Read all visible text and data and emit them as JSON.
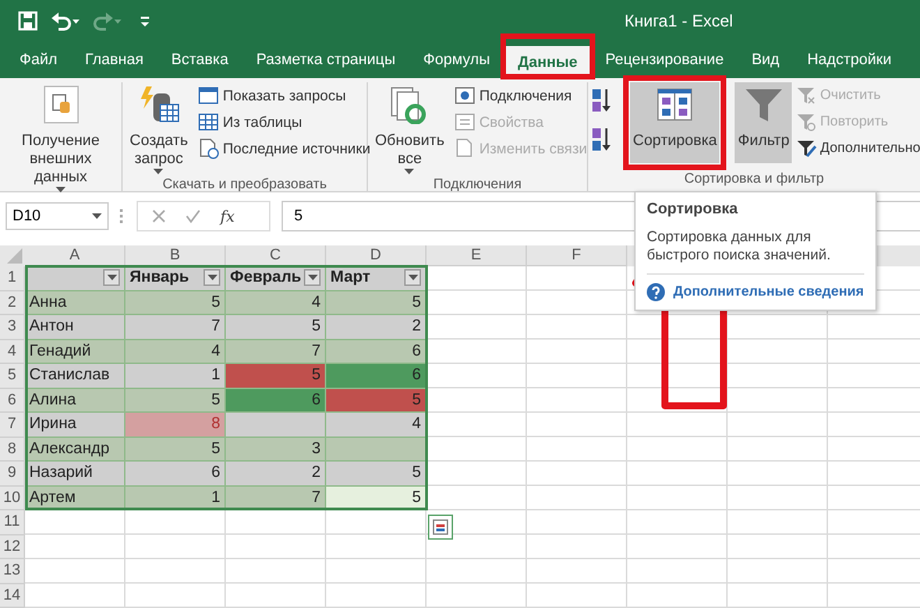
{
  "window": {
    "title": "Книга1  -  Excel"
  },
  "quick_access": [
    {
      "kind": "save",
      "disabled": false
    },
    {
      "kind": "undo",
      "disabled": false
    },
    {
      "kind": "redo",
      "disabled": true
    },
    {
      "kind": "customize",
      "disabled": false
    }
  ],
  "tabs": [
    {
      "label": "Файл",
      "selected": false
    },
    {
      "label": "Главная",
      "selected": false
    },
    {
      "label": "Вставка",
      "selected": false
    },
    {
      "label": "Разметка страницы",
      "selected": false
    },
    {
      "label": "Формулы",
      "selected": false
    },
    {
      "label": "Данные",
      "selected": true
    },
    {
      "label": "Рецензирование",
      "selected": false
    },
    {
      "label": "Вид",
      "selected": false
    },
    {
      "label": "Надстройки",
      "selected": false
    }
  ],
  "ribbon": {
    "groups": [
      {
        "items": [
          {
            "kind": "big",
            "label": "Получение внешних данных",
            "dropdown": true,
            "pressed": false,
            "disabled": false
          }
        ]
      },
      {
        "label": "Скачать и преобразовать",
        "items": [
          {
            "kind": "big",
            "label": "Создать запрос",
            "dropdown": true,
            "pressed": false,
            "disabled": false
          },
          {
            "kind": "small",
            "label": "Показать запросы",
            "disabled": false
          },
          {
            "kind": "small",
            "label": "Из таблицы",
            "disabled": false
          },
          {
            "kind": "small",
            "label": "Последние источники",
            "disabled": false
          }
        ]
      },
      {
        "label": "Подключения",
        "items": [
          {
            "kind": "big",
            "label": "Обновить все",
            "dropdown": true,
            "pressed": false,
            "disabled": false
          },
          {
            "kind": "small",
            "label": "Подключения",
            "disabled": false
          },
          {
            "kind": "small",
            "label": "Свойства",
            "disabled": true
          },
          {
            "kind": "small",
            "label": "Изменить связи",
            "disabled": true
          }
        ]
      },
      {
        "label": "Сортировка и фильтр",
        "items": [
          {
            "kind": "sortpair"
          },
          {
            "kind": "big",
            "label": "Сортировка",
            "dropdown": false,
            "pressed": true,
            "disabled": false
          },
          {
            "kind": "big",
            "label": "Фильтр",
            "dropdown": false,
            "pressed": true,
            "disabled": false
          },
          {
            "kind": "small",
            "label": "Очистить",
            "disabled": true
          },
          {
            "kind": "small",
            "label": "Повторить",
            "disabled": true
          },
          {
            "kind": "small",
            "label": "Дополнительно",
            "disabled": false
          }
        ]
      }
    ]
  },
  "formula_bar": {
    "name_box": "D10",
    "function_button": "fx",
    "value": "5"
  },
  "sheet": {
    "columns": [
      "A",
      "B",
      "C",
      "D",
      "E",
      "F"
    ],
    "rows": [
      {
        "number": "1",
        "cells": [
          {
            "kind": "header"
          },
          {
            "value": "Январь",
            "kind": "header"
          },
          {
            "value": "Февраль",
            "kind": "header"
          },
          {
            "value": "Март",
            "kind": "header"
          }
        ]
      },
      {
        "number": "2",
        "cells": [
          {
            "value": "Анна",
            "kind": "text"
          },
          {
            "value": "5",
            "kind": "number"
          },
          {
            "value": "4",
            "kind": "number"
          },
          {
            "value": "5",
            "kind": "number"
          }
        ]
      },
      {
        "number": "3",
        "cells": [
          {
            "value": "Антон",
            "kind": "text"
          },
          {
            "value": "7",
            "kind": "number"
          },
          {
            "value": "5",
            "kind": "number"
          },
          {
            "value": "2",
            "kind": "number"
          }
        ]
      },
      {
        "number": "4",
        "cells": [
          {
            "value": "Генадий",
            "kind": "text"
          },
          {
            "value": "4",
            "kind": "number"
          },
          {
            "value": "7",
            "kind": "number"
          },
          {
            "value": "6",
            "kind": "number"
          }
        ]
      },
      {
        "number": "5",
        "cells": [
          {
            "value": "Станислав",
            "kind": "text"
          },
          {
            "value": "1",
            "kind": "number"
          },
          {
            "value": "5",
            "kind": "number",
            "color": "#c0504d"
          },
          {
            "value": "6",
            "kind": "number",
            "color": "#4e9a5e"
          }
        ]
      },
      {
        "number": "6",
        "cells": [
          {
            "value": "Алина",
            "kind": "text"
          },
          {
            "value": "5",
            "kind": "number"
          },
          {
            "value": "6",
            "kind": "number",
            "color": "#4e9a5e"
          },
          {
            "value": "5",
            "kind": "number",
            "color": "#c0504d"
          }
        ]
      },
      {
        "number": "7",
        "cells": [
          {
            "value": "Ирина",
            "kind": "text"
          },
          {
            "value": "8",
            "kind": "number",
            "color": "#d4a0a0"
          },
          {
            "kind": "number"
          },
          {
            "value": "4",
            "kind": "number"
          }
        ]
      },
      {
        "number": "8",
        "cells": [
          {
            "value": "Александр",
            "kind": "text"
          },
          {
            "value": "5",
            "kind": "number"
          },
          {
            "value": "3",
            "kind": "number"
          },
          {
            "kind": "number"
          }
        ]
      },
      {
        "number": "9",
        "cells": [
          {
            "value": "Назарий",
            "kind": "text"
          },
          {
            "value": "6",
            "kind": "number"
          },
          {
            "value": "2",
            "kind": "number"
          },
          {
            "value": "5",
            "kind": "number"
          }
        ]
      },
      {
        "number": "10",
        "cells": [
          {
            "value": "Артем",
            "kind": "text"
          },
          {
            "value": "1",
            "kind": "number"
          },
          {
            "value": "7",
            "kind": "number"
          },
          {
            "value": "5",
            "kind": "number",
            "color": "#e6f0de"
          }
        ]
      },
      {
        "number": "11"
      },
      {
        "number": "12"
      },
      {
        "number": "13"
      },
      {
        "number": "14"
      }
    ]
  },
  "tooltip": {
    "title": "Сортировка",
    "text": "Сортировка данных для быстрого поиска значений.",
    "link": "Дополнительные сведения"
  }
}
